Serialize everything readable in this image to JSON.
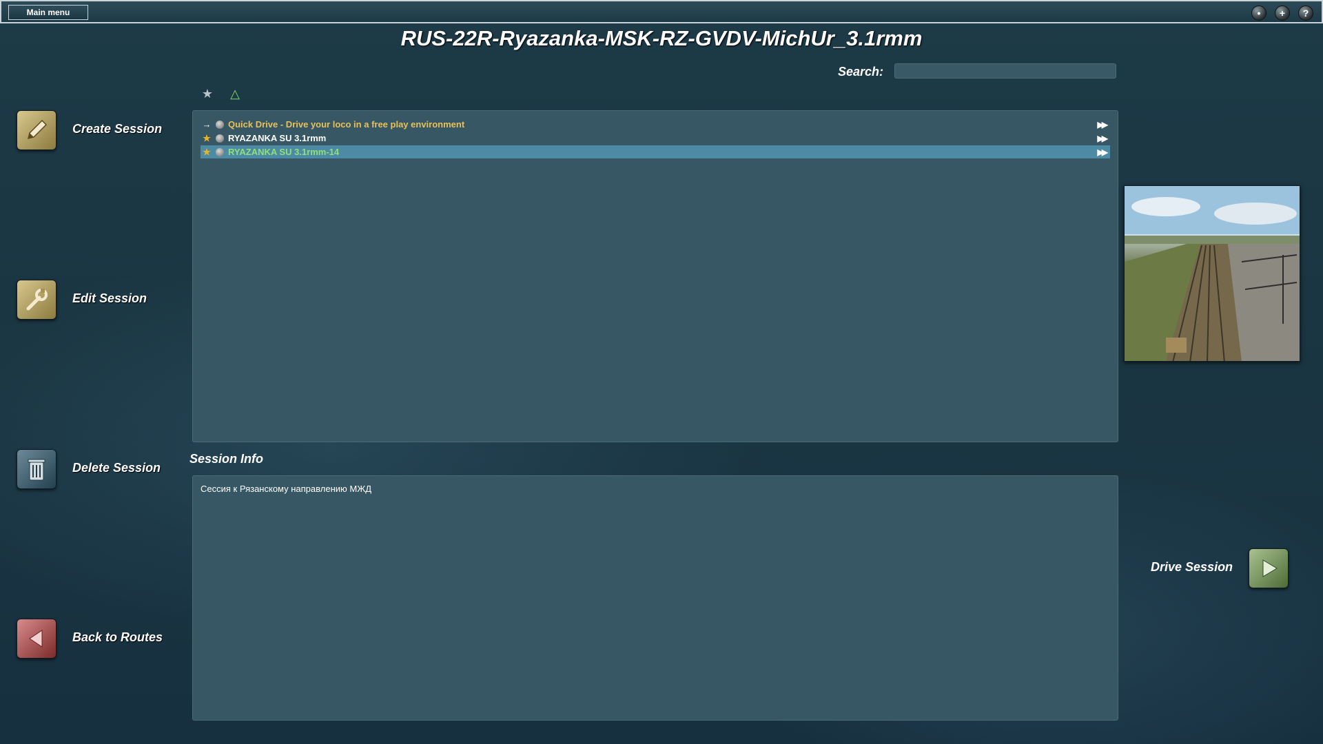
{
  "topbar": {
    "main_menu_label": "Main menu"
  },
  "title": "RUS-22R-Ryazanka-MSK-RZ-GVDV-MichUr_3.1rmm",
  "search": {
    "label": "Search:",
    "value": ""
  },
  "sidebar": {
    "create_label": "Create Session",
    "edit_label": "Edit Session",
    "delete_label": "Delete Session",
    "back_label": "Back to Routes"
  },
  "sessions": [
    {
      "name": "Quick Drive - Drive your loco in a free play environment",
      "color": "#e8c15a",
      "lead": "→",
      "selected": false
    },
    {
      "name": "RYAZANKA SU 3.1rmm",
      "color": "#ffffff",
      "lead": "★",
      "selected": false
    },
    {
      "name": "RYAZANKA SU 3.1rmm-14",
      "color": "#8fe07a",
      "lead": "★",
      "selected": true
    }
  ],
  "session_info": {
    "label": "Session Info",
    "text": "Сессия к Рязанскому направлению МЖД"
  },
  "drive": {
    "label": "Drive Session"
  },
  "colors": {
    "selected_row": "#4d8aa3",
    "panel": "#375764",
    "background": "#1a3542"
  }
}
